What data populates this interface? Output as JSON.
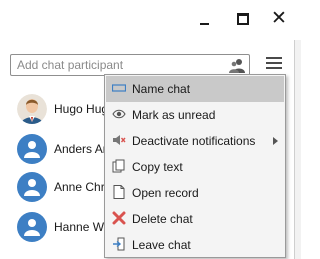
{
  "window": {
    "minimize_icon": "minimize-icon",
    "maximize_icon": "maximize-icon",
    "close_glyph": "✕"
  },
  "search": {
    "placeholder": "Add chat participant",
    "icon": "add-people-icon"
  },
  "menu_button": {
    "icon": "hamburger-menu-icon"
  },
  "participants": [
    {
      "name": "Hugo Hugo",
      "avatar": "person-photo"
    },
    {
      "name": "Anders An",
      "avatar": "generic-person-icon"
    },
    {
      "name": "Anne Chri",
      "avatar": "generic-person-icon"
    },
    {
      "name": "Hanne Wi",
      "avatar": "generic-person-icon"
    }
  ],
  "context_menu": {
    "items": [
      {
        "label": "Name chat",
        "icon": "rename-icon",
        "highlighted": true
      },
      {
        "label": "Mark as unread",
        "icon": "eye-icon"
      },
      {
        "label": "Deactivate notifications",
        "icon": "mute-icon",
        "has_submenu": true
      },
      {
        "label": "Copy text",
        "icon": "copy-icon"
      },
      {
        "label": "Open record",
        "icon": "document-icon"
      },
      {
        "label": "Delete chat",
        "icon": "delete-icon"
      },
      {
        "label": "Leave chat",
        "icon": "leave-icon"
      }
    ]
  },
  "colors": {
    "highlight": "#c9c9c9",
    "avatar_blue": "#3d7fc4",
    "delete_red": "#d9534f"
  }
}
